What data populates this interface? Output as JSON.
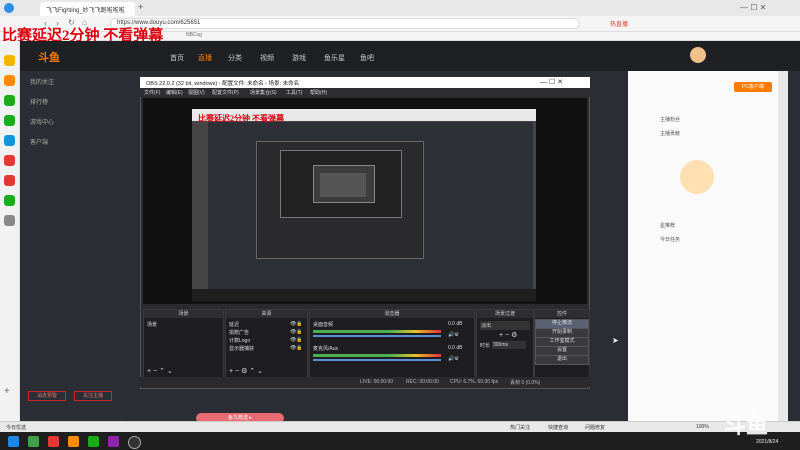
{
  "browser": {
    "tab_title": "飞飞Fighting_妙飞飞跑啦啦啦",
    "url": "https://www.douyu.com/625651",
    "bookmark_label": "NBCsg",
    "new_tab": "+",
    "badge": "热直播"
  },
  "overlay_title": "比赛延迟2分钟 不看弹幕",
  "douyu": {
    "nav": [
      "首页",
      "直播",
      "分类",
      "视频",
      "游戏",
      "鱼乐星",
      "鱼吧",
      "赛事"
    ],
    "sidebar": [
      "我的关注",
      "排行榜",
      "游戏中心",
      "客户端"
    ],
    "sidebar_bottom": [
      "消息预警",
      "关注主播"
    ],
    "right_items": [
      "主播粉丝",
      "主播贡献",
      "星推荐",
      "今日任务"
    ],
    "right_btn": "PC客户端",
    "pink_button": "鱼丸赠送 ▸"
  },
  "obs": {
    "title": "OBS 22.0.2 (32 bit, windows) - 配置文件: 未命名 - 场景: 未命名",
    "menu": [
      "文件(F)",
      "编辑(E)",
      "视图(V)",
      "配置文件(P)",
      "场景集合(S)",
      "工具(T)",
      "帮助(H)"
    ],
    "panels": {
      "scenes": "场景",
      "sources": "来源",
      "mixer": "混音器",
      "transitions": "场景过渡",
      "controls": "控件"
    },
    "scene_items": [
      "场景"
    ],
    "source_items": [
      "延迟",
      "捐赠广告",
      "计数Logo",
      "显示器捕获"
    ],
    "mixer_tracks": [
      {
        "name": "桌面音频",
        "db": "0.0 dB"
      },
      {
        "name": "麦克风/Aux",
        "db": "0.0 dB"
      }
    ],
    "transition": "淡出",
    "duration_label": "时长",
    "duration_value": "300ms",
    "controls": [
      "停止推流",
      "开始录制",
      "工作室模式",
      "设置",
      "退出"
    ],
    "status": {
      "live": "LIVE: 00:00:00",
      "rec": "REC: 00:00:00",
      "cpu": "CPU: 6.7%, 60.00 fps",
      "dropped": "丢帧 0 (0.0%)"
    }
  },
  "taskbar": {
    "left_status": "今日优选",
    "right_status": [
      "热门关注",
      "快捷查询",
      "问题修复"
    ],
    "clock": "2021/8/24",
    "zoom": "100%"
  },
  "watermark": "斗鱼"
}
